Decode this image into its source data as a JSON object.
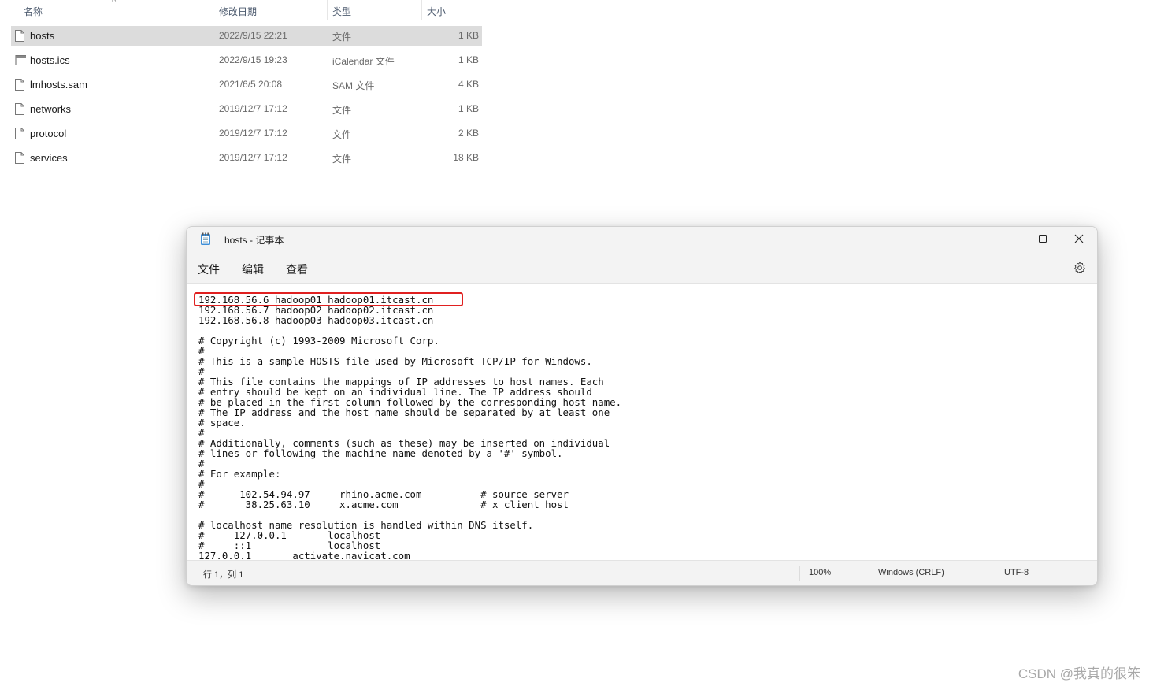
{
  "explorer": {
    "columns": {
      "name": "名称",
      "modified": "修改日期",
      "type": "类型",
      "size": "大小"
    },
    "sort_indicator": "^",
    "files": [
      {
        "name": "hosts",
        "modified": "2022/9/15 22:21",
        "type": "文件",
        "size": "1 KB",
        "selected": true,
        "icon": "file-icon"
      },
      {
        "name": "hosts.ics",
        "modified": "2022/9/15 19:23",
        "type": "iCalendar 文件",
        "size": "1 KB",
        "selected": false,
        "icon": "calendar-file-icon"
      },
      {
        "name": "lmhosts.sam",
        "modified": "2021/6/5 20:08",
        "type": "SAM 文件",
        "size": "4 KB",
        "selected": false,
        "icon": "file-icon"
      },
      {
        "name": "networks",
        "modified": "2019/12/7 17:12",
        "type": "文件",
        "size": "1 KB",
        "selected": false,
        "icon": "file-icon"
      },
      {
        "name": "protocol",
        "modified": "2019/12/7 17:12",
        "type": "文件",
        "size": "2 KB",
        "selected": false,
        "icon": "file-icon"
      },
      {
        "name": "services",
        "modified": "2019/12/7 17:12",
        "type": "文件",
        "size": "18 KB",
        "selected": false,
        "icon": "file-icon"
      }
    ],
    "selected_color": "#dcdcdc"
  },
  "notepad": {
    "title": "hosts - 记事本",
    "menu": {
      "file": "文件",
      "edit": "编辑",
      "view": "查看"
    },
    "content": "192.168.56.6 hadoop01 hadoop01.itcast.cn\n192.168.56.7 hadoop02 hadoop02.itcast.cn\n192.168.56.8 hadoop03 hadoop03.itcast.cn\n\n# Copyright (c) 1993-2009 Microsoft Corp.\n#\n# This is a sample HOSTS file used by Microsoft TCP/IP for Windows.\n#\n# This file contains the mappings of IP addresses to host names. Each\n# entry should be kept on an individual line. The IP address should\n# be placed in the first column followed by the corresponding host name.\n# The IP address and the host name should be separated by at least one\n# space.\n#\n# Additionally, comments (such as these) may be inserted on individual\n# lines or following the machine name denoted by a '#' symbol.\n#\n# For example:\n#\n#      102.54.94.97     rhino.acme.com          # source server\n#       38.25.63.10     x.acme.com              # x client host\n\n# localhost name resolution is handled within DNS itself.\n#     127.0.0.1       localhost\n#     ::1             localhost\n127.0.0.1       activate.navicat.com",
    "status": {
      "cursor": "行 1，列 1",
      "zoom": "100%",
      "line_ending": "Windows (CRLF)",
      "encoding": "UTF-8"
    },
    "highlight_color": "#e02020"
  },
  "watermark": "CSDN @我真的很笨"
}
